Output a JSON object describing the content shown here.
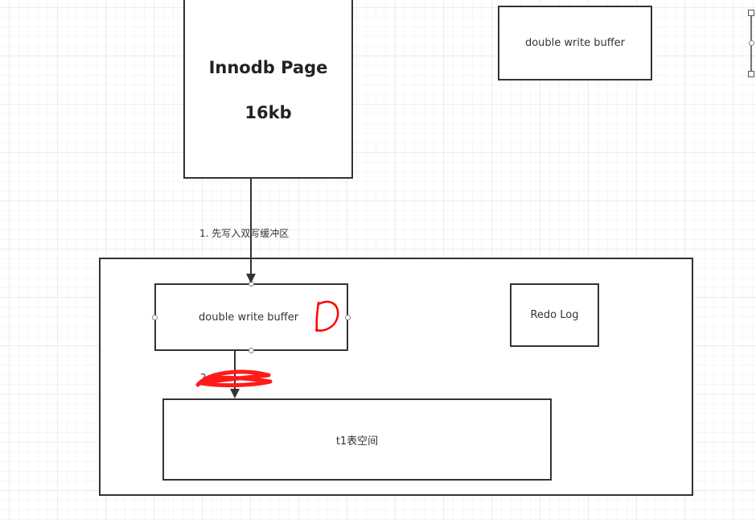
{
  "nodes": {
    "innodb_page": {
      "line1": "Innodb Page",
      "line2": "16kb"
    },
    "dwb_top": {
      "label": "double write buffer"
    },
    "dwb_main": {
      "label": "double write buffer"
    },
    "redo_log": {
      "label": "Redo Log"
    },
    "t1_space": {
      "label": "t1表空间"
    }
  },
  "edges": {
    "edge1": {
      "label": "1. 先写入双写缓冲区"
    },
    "edge2": {
      "label": "2. 写"
    }
  },
  "colors": {
    "stroke": "#333333",
    "annotation_red": "#ff0000",
    "grid": "#ececec"
  }
}
